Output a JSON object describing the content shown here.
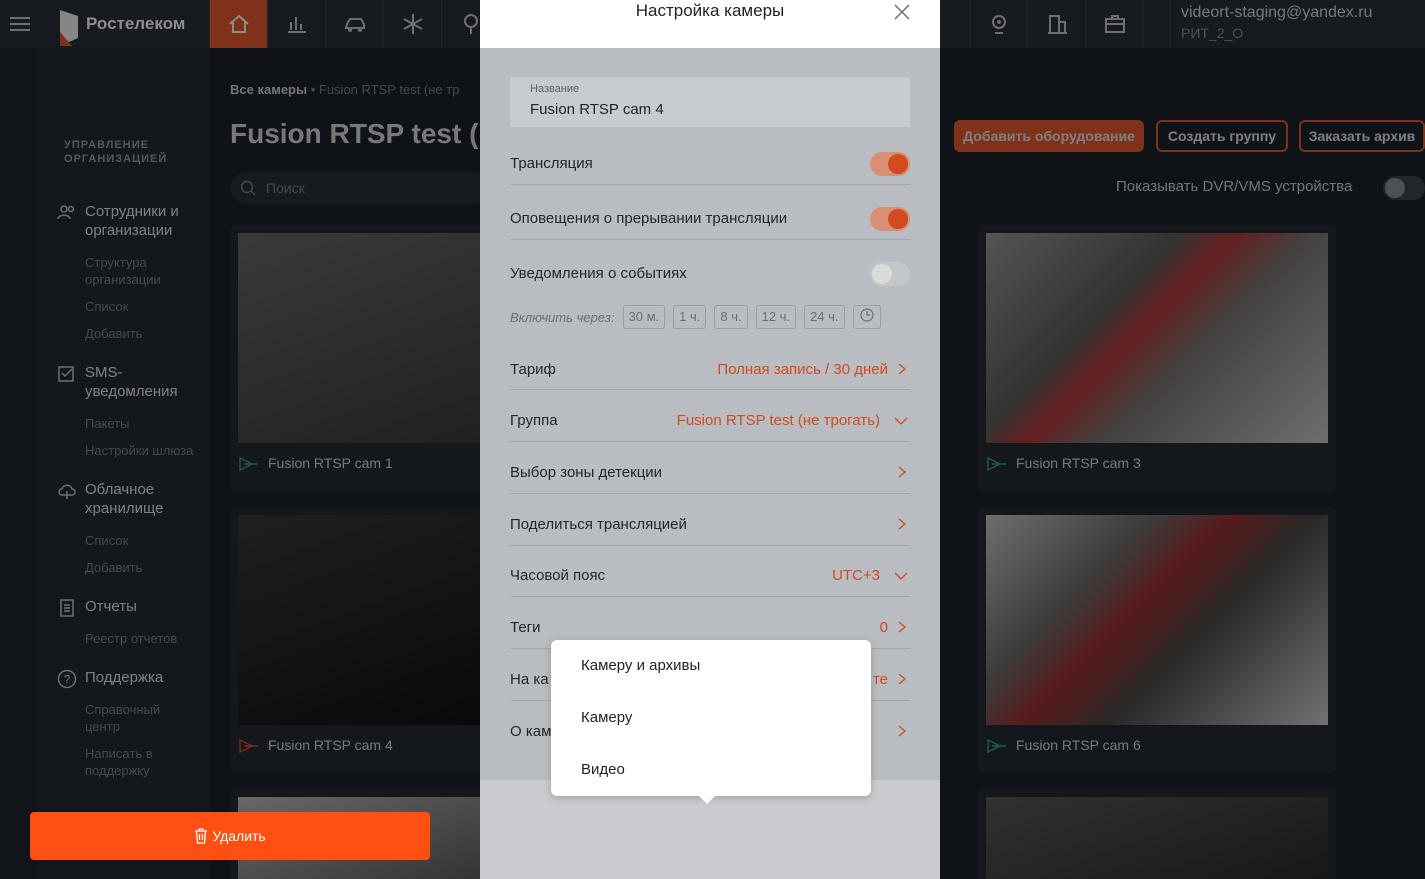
{
  "header": {
    "logo_text": "Ростелеком",
    "nav_icons": [
      "home-icon",
      "chart-icon",
      "car-icon",
      "snowflake-icon",
      "tree-icon",
      "camera-icon",
      "building-icon",
      "briefcase-icon"
    ],
    "user_email": "videort-staging@yandex.ru",
    "user_org": "РИТ_2_О"
  },
  "sidebar": {
    "heading": "УПРАВЛЕНИЕ ОРГАНИЗАЦИЕЙ",
    "sections": [
      {
        "label": "Сотрудники и организации",
        "items": [
          "Структура организации",
          "Список",
          "Добавить"
        ]
      },
      {
        "label": "SMS-уведомления",
        "items": [
          "Пакеты",
          "Настройки шлюза"
        ]
      },
      {
        "label": "Облачное хранилище",
        "items": [
          "Список",
          "Добавить"
        ]
      },
      {
        "label": "Отчеты",
        "items": [
          "Реестр отчетов"
        ]
      },
      {
        "label": "Поддержка",
        "items": [
          "Справочный центр",
          "Написать в поддержку"
        ]
      }
    ]
  },
  "main": {
    "breadcrumb_root": "Все камеры",
    "breadcrumb_current": "Fusion RTSP test (не тр",
    "title": "Fusion RTSP test (н",
    "search_placeholder": "Поиск",
    "btn_add": "Добавить оборудование",
    "btn_group": "Создать группу",
    "btn_archive": "Заказать архив",
    "dvr_label": "Показывать DVR/VMS устройства",
    "cameras": [
      {
        "name": "Fusion RTSP cam 1",
        "status": "online"
      },
      {
        "name": "Fusion RTSP cam 3",
        "status": "online"
      },
      {
        "name": "Fusion RTSP cam 4",
        "status": "offline"
      },
      {
        "name": "Fusion RTSP cam 6",
        "status": "online"
      }
    ]
  },
  "modal": {
    "title": "Настройка камеры",
    "name_label": "Название",
    "name_value": "Fusion RTSP cam 4",
    "streaming": "Трансляция",
    "interrupt_alerts": "Оповещения о прерывании трансляции",
    "event_notifications": "Уведомления о событиях",
    "enable_via": "Включить через:",
    "durations": [
      "30 м.",
      "1 ч.",
      "8 ч.",
      "12 ч.",
      "24 ч."
    ],
    "tariff_label": "Тариф",
    "tariff_value": "Полная запись / 30 дней",
    "group_label": "Группа",
    "group_value": "Fusion RTSP test (не трогать)",
    "zone_label": "Выбор зоны детекции",
    "share_label": "Поделиться трансляцией",
    "tz_label": "Часовой пояс",
    "tz_value": "UTC+3",
    "tags_label": "Теги",
    "tags_value": "0",
    "map_label": "На ка",
    "map_value": "те",
    "about_label": "О кам",
    "delete_label": "Удалить"
  },
  "popup": {
    "options": [
      "Камеру и архивы",
      "Камеру",
      "Видео"
    ]
  },
  "colors": {
    "accent": "#e85c2f",
    "delete": "#ff4f12"
  }
}
